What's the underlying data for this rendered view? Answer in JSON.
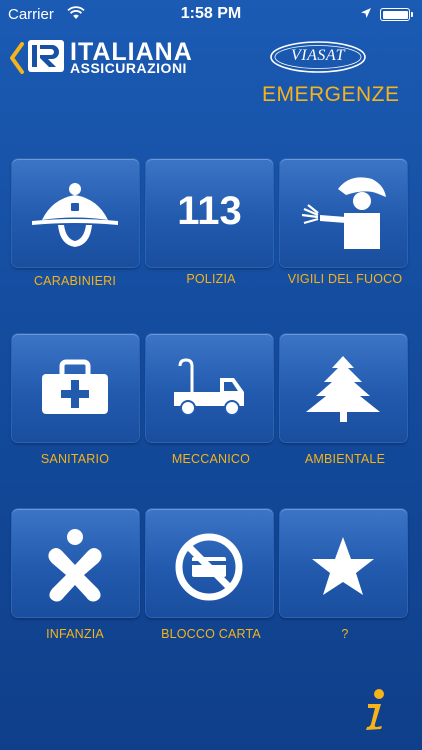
{
  "status_bar": {
    "carrier": "Carrier",
    "time": "1:58 PM"
  },
  "header": {
    "logo_line1": "ITALIANA",
    "logo_line2": "ASSICURAZIONI",
    "partner_logo": "VIASAT",
    "title": "EMERGENZE"
  },
  "tiles": [
    {
      "label": "CARABINIERI",
      "icon": "carabinieri-hat-icon"
    },
    {
      "label": "POLIZIA",
      "icon_text": "113"
    },
    {
      "label": "VIGILI DEL FUOCO",
      "icon": "firefighter-icon"
    },
    {
      "label": "SANITARIO",
      "icon": "first-aid-kit-icon"
    },
    {
      "label": "MECCANICO",
      "icon": "tow-truck-icon"
    },
    {
      "label": "AMBIENTALE",
      "icon": "tree-icon"
    },
    {
      "label": "INFANZIA",
      "icon": "child-icon"
    },
    {
      "label": "BLOCCO CARTA",
      "icon": "no-card-icon"
    },
    {
      "label": "?",
      "icon": "star-icon"
    }
  ],
  "colors": {
    "background": "#1751a6",
    "accent": "#f6b31a",
    "tile": "#2a63b6"
  }
}
